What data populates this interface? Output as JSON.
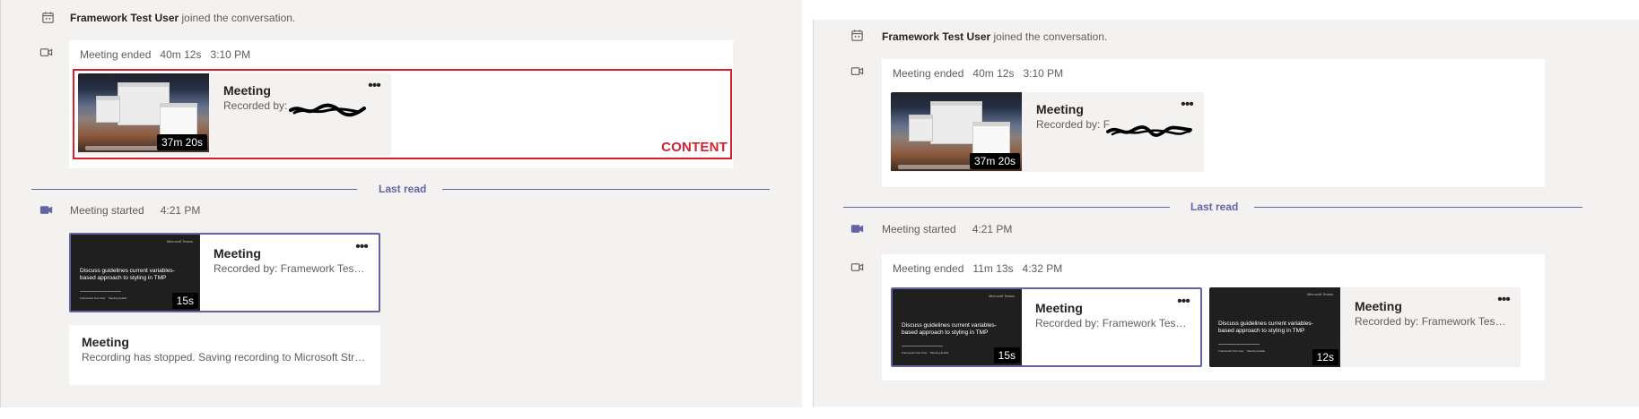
{
  "left": {
    "join": {
      "name": "Framework Test User",
      "text": " joined the conversation."
    },
    "meeting_ended": {
      "label": "Meeting ended",
      "duration": "40m 12s",
      "time": "3:10 PM"
    },
    "recording": {
      "title": "Meeting",
      "recorded_by_prefix": "Recorded by: ",
      "duration": "37m 20s"
    },
    "annotation_label": "CONTENT",
    "divider_label": "Last read",
    "meeting_started": {
      "label": "Meeting started",
      "time": "4:21 PM"
    },
    "started_card": {
      "title": "Meeting",
      "recorded_by": "Recorded by: Framework Test U...",
      "duration": "15s",
      "slide_title": "Discuss guidelines current variables-based approach to styling in TMP",
      "slide_brand": "Microsoft Teams",
      "slide_footer_left": "Framework Test User",
      "slide_footer_right": "Meeting details"
    },
    "status_card": {
      "title": "Meeting",
      "text": "Recording has stopped. Saving recording to Microsoft Strea..."
    }
  },
  "right": {
    "join": {
      "name": "Framework Test User",
      "text": " joined the conversation."
    },
    "meeting_ended": {
      "label": "Meeting ended",
      "duration": "40m 12s",
      "time": "3:10 PM"
    },
    "recording": {
      "title": "Meeting",
      "recorded_by_prefix": "Recorded by: F",
      "duration": "37m 20s"
    },
    "divider_label": "Last read",
    "meeting_started": {
      "label": "Meeting started",
      "time": "4:21 PM"
    },
    "meeting_ended_second": {
      "label": "Meeting ended",
      "duration": "11m 13s",
      "time": "4:32 PM"
    },
    "cards": [
      {
        "title": "Meeting",
        "recorded_by": "Recorded by: Framework Test U...",
        "duration": "15s",
        "slide_title": "Discuss guidelines current variables-based approach to styling in TMP",
        "slide_brand": "Microsoft Teams",
        "slide_footer_left": "Framework Test User",
        "slide_footer_right": "Meeting details"
      },
      {
        "title": "Meeting",
        "recorded_by": "Recorded by: Framework Test U...",
        "duration": "12s",
        "slide_title": "Discuss guidelines current variables-based approach to styling in TMP",
        "slide_brand": "Microsoft Teams",
        "slide_footer_left": "Framework Test User",
        "slide_footer_right": "Meeting details"
      }
    ]
  },
  "colors": {
    "pane_background": "#f3f2f1",
    "card_background": "#ffffff",
    "accent": "#6264a7",
    "annotation_red": "#d71f2d",
    "text_primary": "#252423",
    "text_secondary": "#605e5c"
  },
  "icons": {
    "join": "calendar-people-icon",
    "meeting": "video-camera-icon",
    "more": "more-options-icon"
  }
}
